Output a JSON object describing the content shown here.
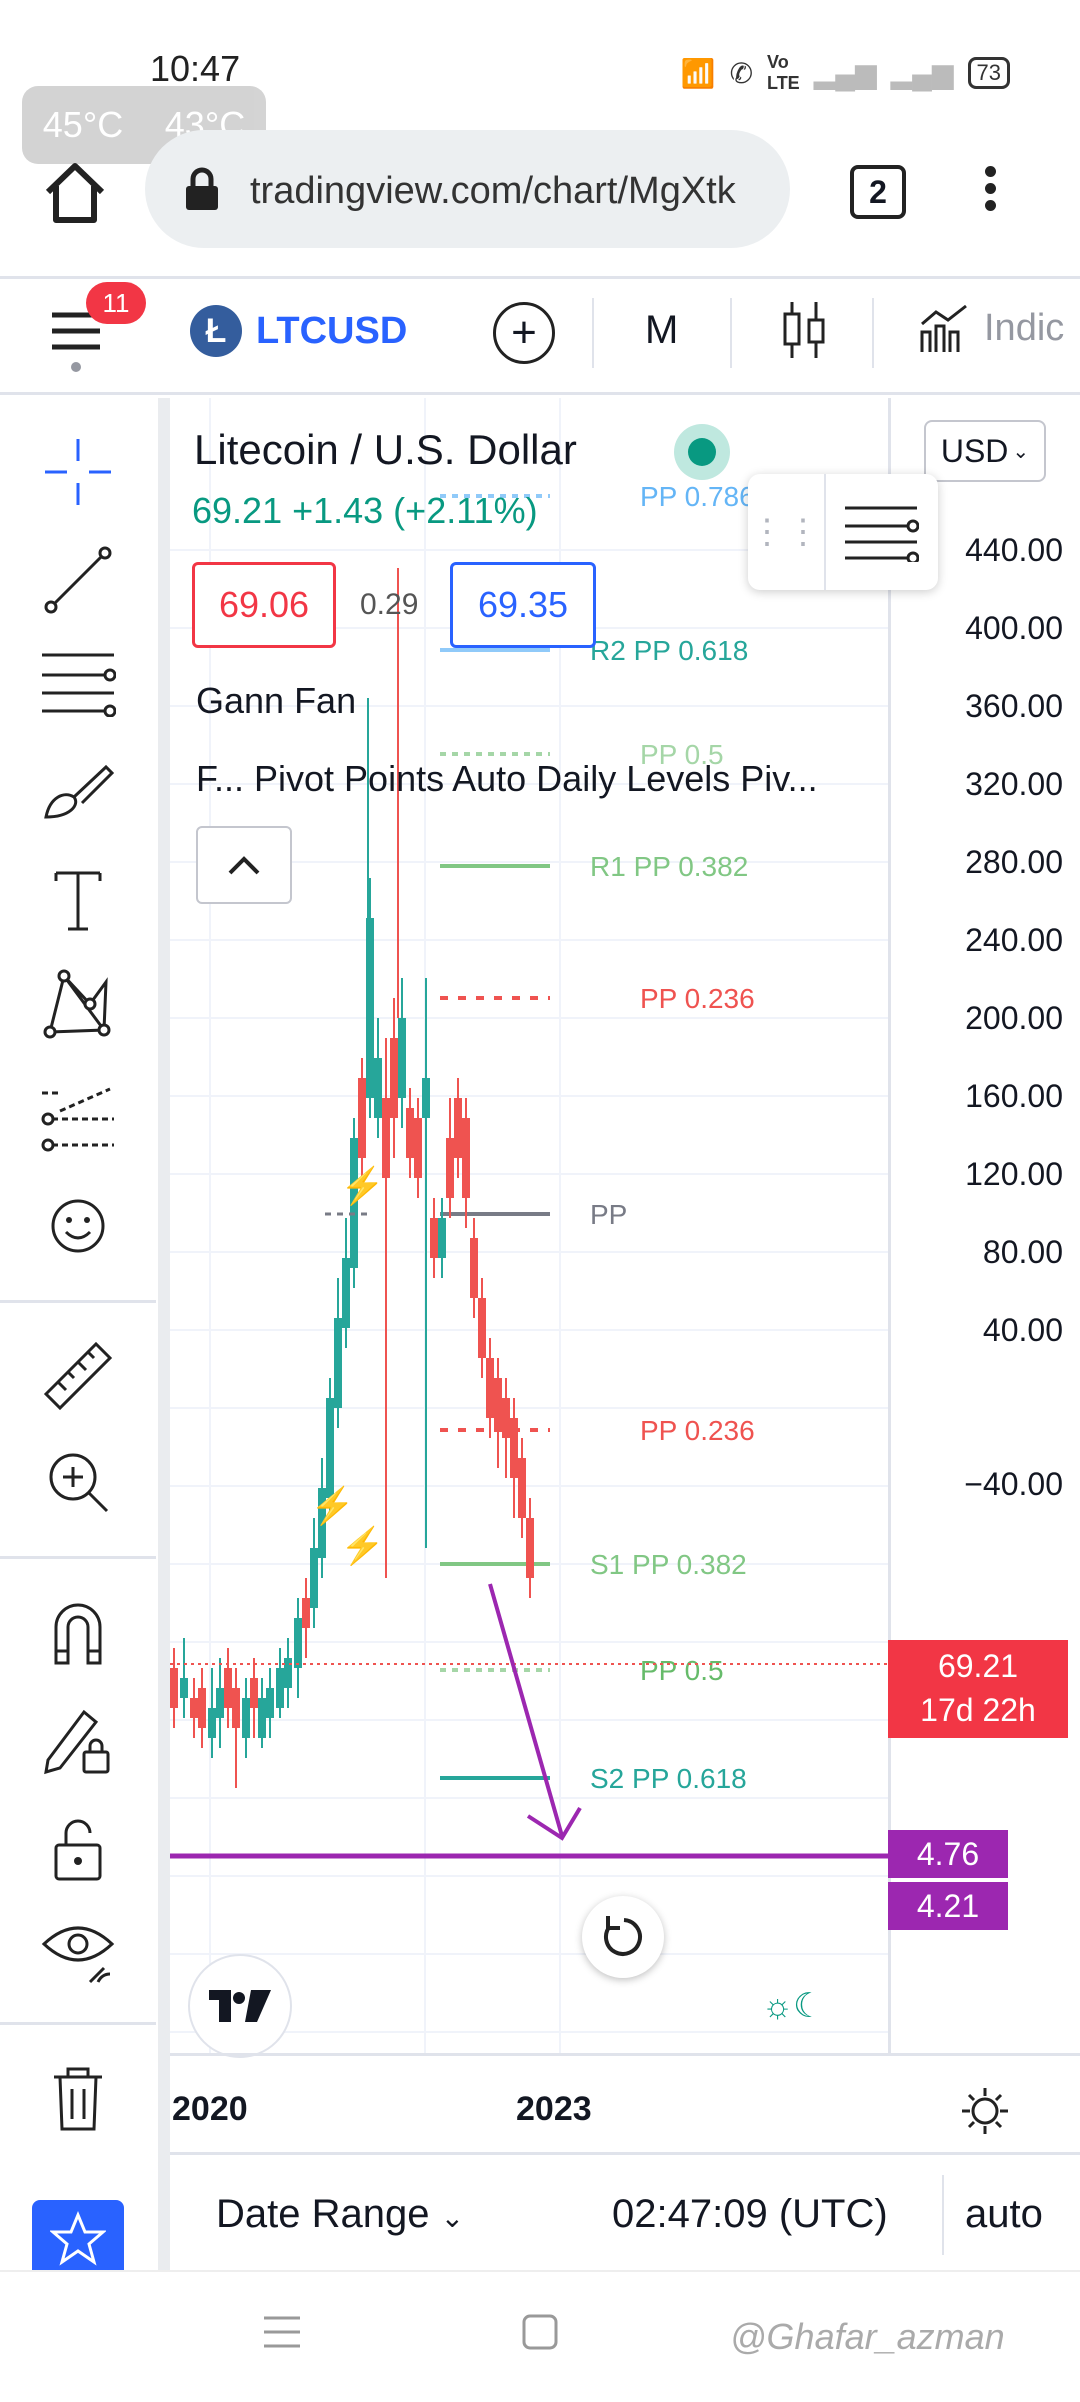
{
  "status_bar": {
    "time": "10:47",
    "temp1": "45°C",
    "temp2": "43°C",
    "battery": "73"
  },
  "browser": {
    "url": "tradingview.com/chart/MgXtk",
    "tab_count": "2"
  },
  "toolbar": {
    "notification_count": "11",
    "symbol": "LTCUSD",
    "interval": "M",
    "indicators_label": "Indic"
  },
  "legend": {
    "title": "Litecoin / U.S. Dollar",
    "price_change": "69.21  +1.43 (+2.11%)",
    "bid": "69.06",
    "spread": "0.29",
    "ask": "69.35",
    "study1": "Gann Fan",
    "study2": "F...  Pivot Points Auto Daily Levels Piv..."
  },
  "currency": "USD",
  "price_axis": [
    "440.00",
    "400.00",
    "360.00",
    "320.00",
    "280.00",
    "240.00",
    "200.00",
    "160.00",
    "120.00",
    "80.00",
    "40.00",
    "−40.00"
  ],
  "last_price": {
    "value": "69.21",
    "countdown": "17d 22h"
  },
  "purple_labels": [
    "4.76",
    "4.21"
  ],
  "pivot_labels": [
    "PP 0.786",
    "R2 PP 0.618",
    "PP 0.5",
    "R1 PP 0.382",
    "PP 0.236",
    "PP",
    "PP 0.236",
    "S1 PP 0.382",
    "PP 0.5",
    "S2 PP 0.618"
  ],
  "time_axis": [
    "2020",
    "2023"
  ],
  "bottom_bar": {
    "date_range": "Date Range",
    "clock": "02:47:09 (UTC)",
    "scale": "auto"
  },
  "watermark": "@Ghafar_azman",
  "colors": {
    "up": "#26a69a",
    "down": "#ef5350",
    "accent": "#2962ff",
    "purple": "#9c27b0"
  }
}
